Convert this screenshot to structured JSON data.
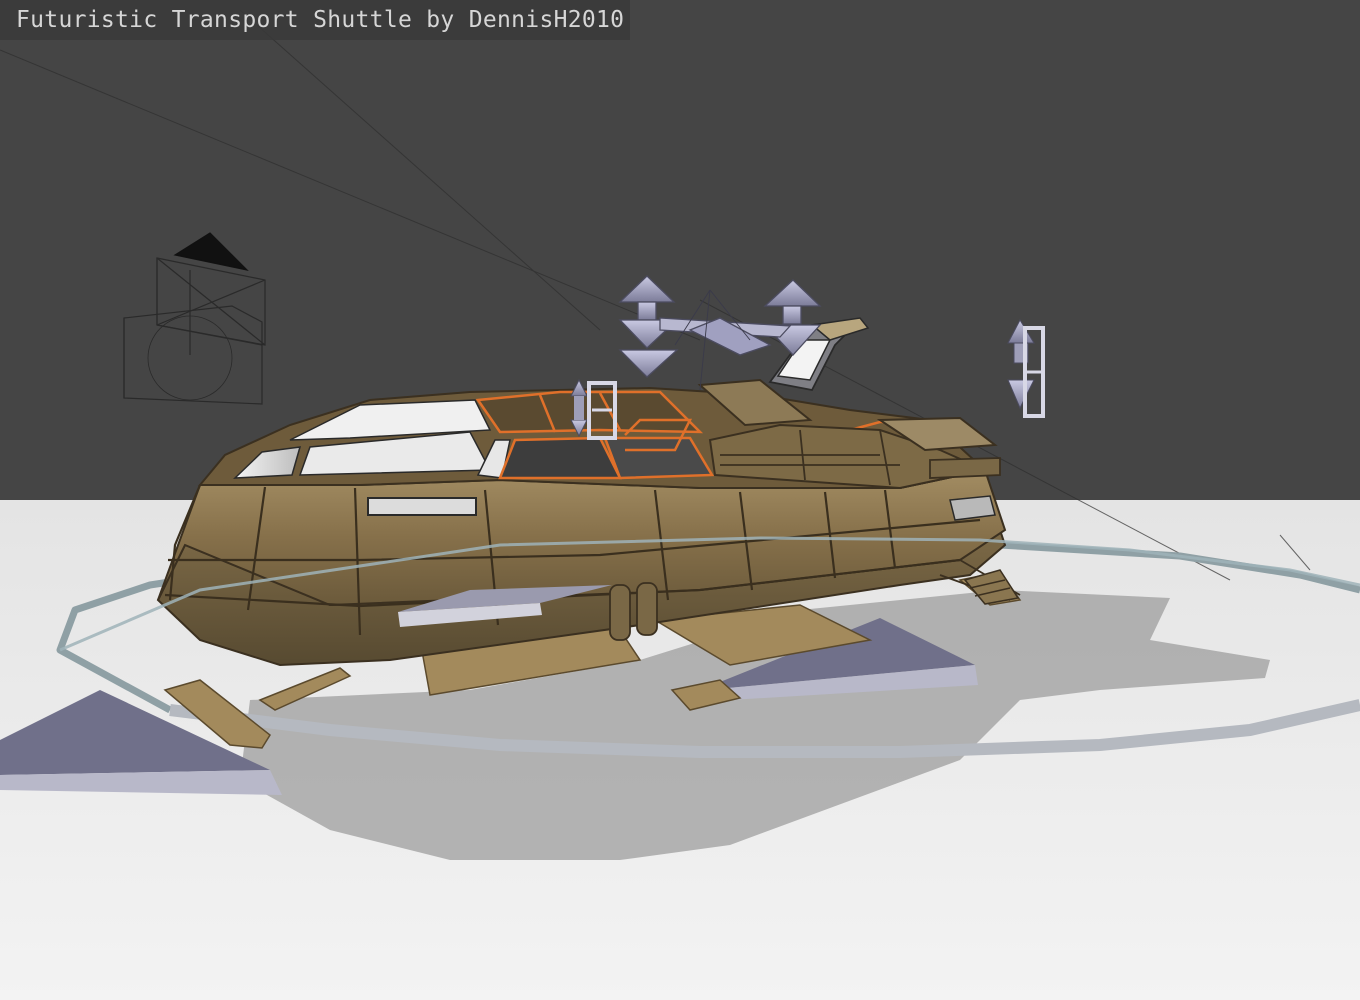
{
  "viewport": {
    "title": "Futuristic Transport Shuttle by DennisH2010"
  },
  "colors": {
    "background": "#454545",
    "floor": "#e9e9e9",
    "hull": "#8a7550",
    "hull_dark": "#4a3d26",
    "canopy_trim": "#e0702a",
    "gizmo": "#a9a9c8",
    "ring": "#b9bdc4"
  },
  "icons": {
    "camera": "camera-frame-icon",
    "lamp": "spot-lamp-icon",
    "thruster": "thruster-gizmo-icon"
  }
}
